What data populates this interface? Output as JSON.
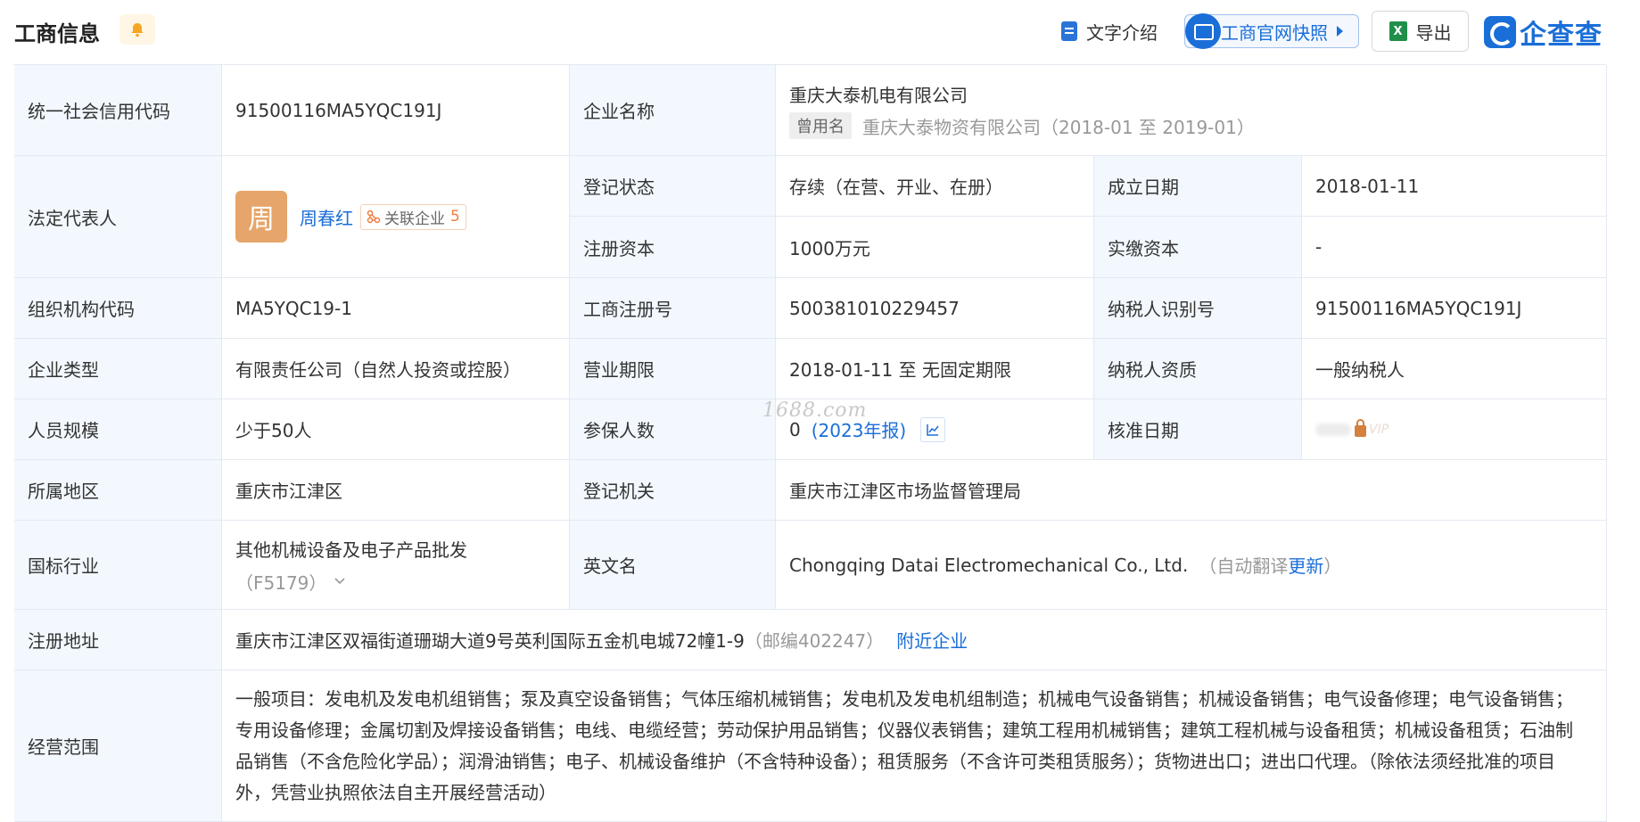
{
  "header": {
    "title": "工商信息",
    "text_intro": "文字介绍",
    "snapshot": "工商官网快照",
    "export": "导出",
    "brand": "企查查"
  },
  "fields": {
    "credit_code_label": "统一社会信用代码",
    "credit_code": "91500116MA5YQC191J",
    "company_name_label": "企业名称",
    "company_name": "重庆大泰机电有限公司",
    "former_name_tag": "曾用名",
    "former_name": "重庆大泰物资有限公司（2018-01 至 2019-01）",
    "legal_rep_label": "法定代表人",
    "legal_rep_avatar": "周",
    "legal_rep_name": "周春红",
    "related_label": "关联企业",
    "related_count": "5",
    "reg_status_label": "登记状态",
    "reg_status": "存续（在营、开业、在册）",
    "found_date_label": "成立日期",
    "found_date": "2018-01-11",
    "reg_capital_label": "注册资本",
    "reg_capital": "1000万元",
    "paid_capital_label": "实缴资本",
    "paid_capital": "-",
    "org_code_label": "组织机构代码",
    "org_code": "MA5YQC19-1",
    "biz_reg_no_label": "工商注册号",
    "biz_reg_no": "500381010229457",
    "taxpayer_id_label": "纳税人识别号",
    "taxpayer_id": "91500116MA5YQC191J",
    "company_type_label": "企业类型",
    "company_type": "有限责任公司（自然人投资或控股）",
    "biz_term_label": "营业期限",
    "biz_term": "2018-01-11 至 无固定期限",
    "taxpayer_qual_label": "纳税人资质",
    "taxpayer_qual": "一般纳税人",
    "staff_size_label": "人员规模",
    "staff_size": "少于50人",
    "insured_label": "参保人数",
    "insured": "0",
    "insured_year": "(2023年报)",
    "approval_date_label": "核准日期",
    "vip_text": "VIP",
    "region_label": "所属地区",
    "region": "重庆市江津区",
    "reg_authority_label": "登记机关",
    "reg_authority": "重庆市江津区市场监督管理局",
    "industry_label": "国标行业",
    "industry": "其他机械设备及电子产品批发",
    "industry_code": "（F5179）",
    "english_name_label": "英文名",
    "english_name": "Chongqing Datai Electromechanical Co., Ltd.",
    "auto_translate_prefix": "（自动翻译",
    "auto_translate_link": "更新",
    "auto_translate_suffix": "）",
    "reg_address_label": "注册地址",
    "reg_address": "重庆市江津区双福街道珊瑚大道9号英利国际五金机电城72幢1-9",
    "postcode": "（邮编402247）",
    "nearby": "附近企业",
    "scope_label": "经营范围",
    "scope": "一般项目：发电机及发电机组销售；泵及真空设备销售；气体压缩机械销售；发电机及发电机组制造；机械电气设备销售；机械设备销售；电气设备修理；电气设备销售；专用设备修理；金属切割及焊接设备销售；电线、电缆经营；劳动保护用品销售；仪器仪表销售；建筑工程用机械销售；建筑工程机械与设备租赁；机械设备租赁；石油制品销售（不含危险化学品）；润滑油销售；电子、机械设备维护（不含特种设备）；租赁服务（不含许可类租赁服务）；货物进出口；进出口代理。（除依法须经批准的项目外，凭营业执照依法自主开展经营活动）"
  },
  "watermark": "1688.com",
  "colors": {
    "accent": "#1a6ed8",
    "label_bg": "#f2f8fe",
    "border": "#e4e9f1",
    "avatar": "#e6a56a",
    "related_count": "#f07d3d"
  }
}
